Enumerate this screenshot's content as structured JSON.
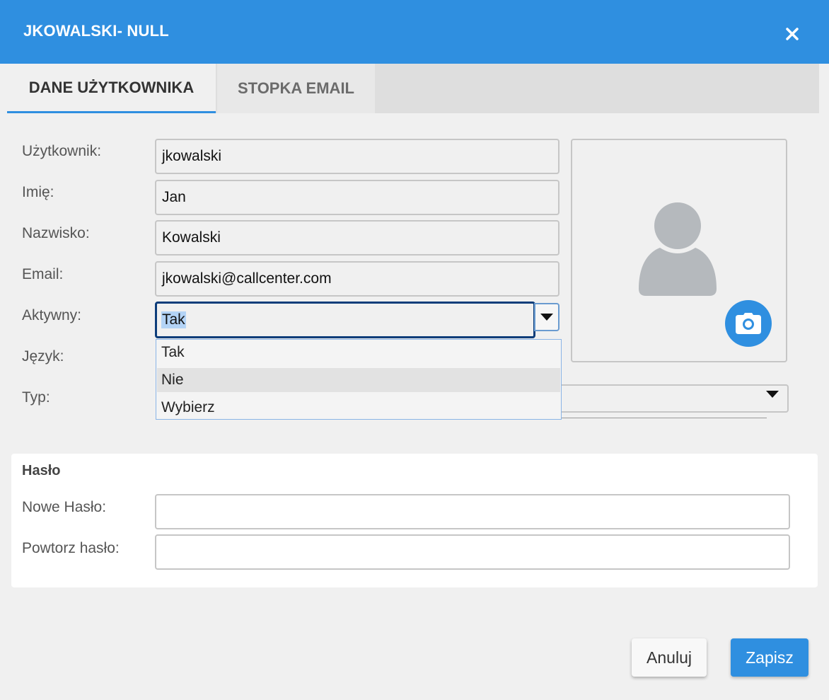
{
  "dialog": {
    "title": "JKOWALSKI- NULL"
  },
  "tabs": [
    {
      "label": "DANE UŻYTKOWNIKA",
      "active": true
    },
    {
      "label": "STOPKA EMAIL",
      "active": false
    }
  ],
  "form": {
    "username_label": "Użytkownik:",
    "username_value": "jkowalski",
    "firstname_label": "Imię:",
    "firstname_value": "Jan",
    "lastname_label": "Nazwisko:",
    "lastname_value": "Kowalski",
    "email_label": "Email:",
    "email_value": "jkowalski@callcenter.com",
    "active_label": "Aktywny:",
    "active_value": "Tak",
    "active_options": [
      "Tak",
      "Nie",
      "Wybierz"
    ],
    "language_label": "Język:",
    "type_label": "Typ:"
  },
  "password": {
    "section_title": "Hasło",
    "new_label": "Nowe Hasło:",
    "new_value": "",
    "repeat_label": "Powtorz hasło:",
    "repeat_value": ""
  },
  "buttons": {
    "cancel_label": "Anuluj",
    "save_label": "Zapisz"
  },
  "colors": {
    "accent": "#2f8fe0",
    "title_text": "#ffffff",
    "avatar": "#b5b9bd"
  },
  "icons": {
    "close": "close-icon",
    "avatar": "user-avatar-icon",
    "camera": "camera-icon",
    "dropdown": "caret-down-icon"
  }
}
